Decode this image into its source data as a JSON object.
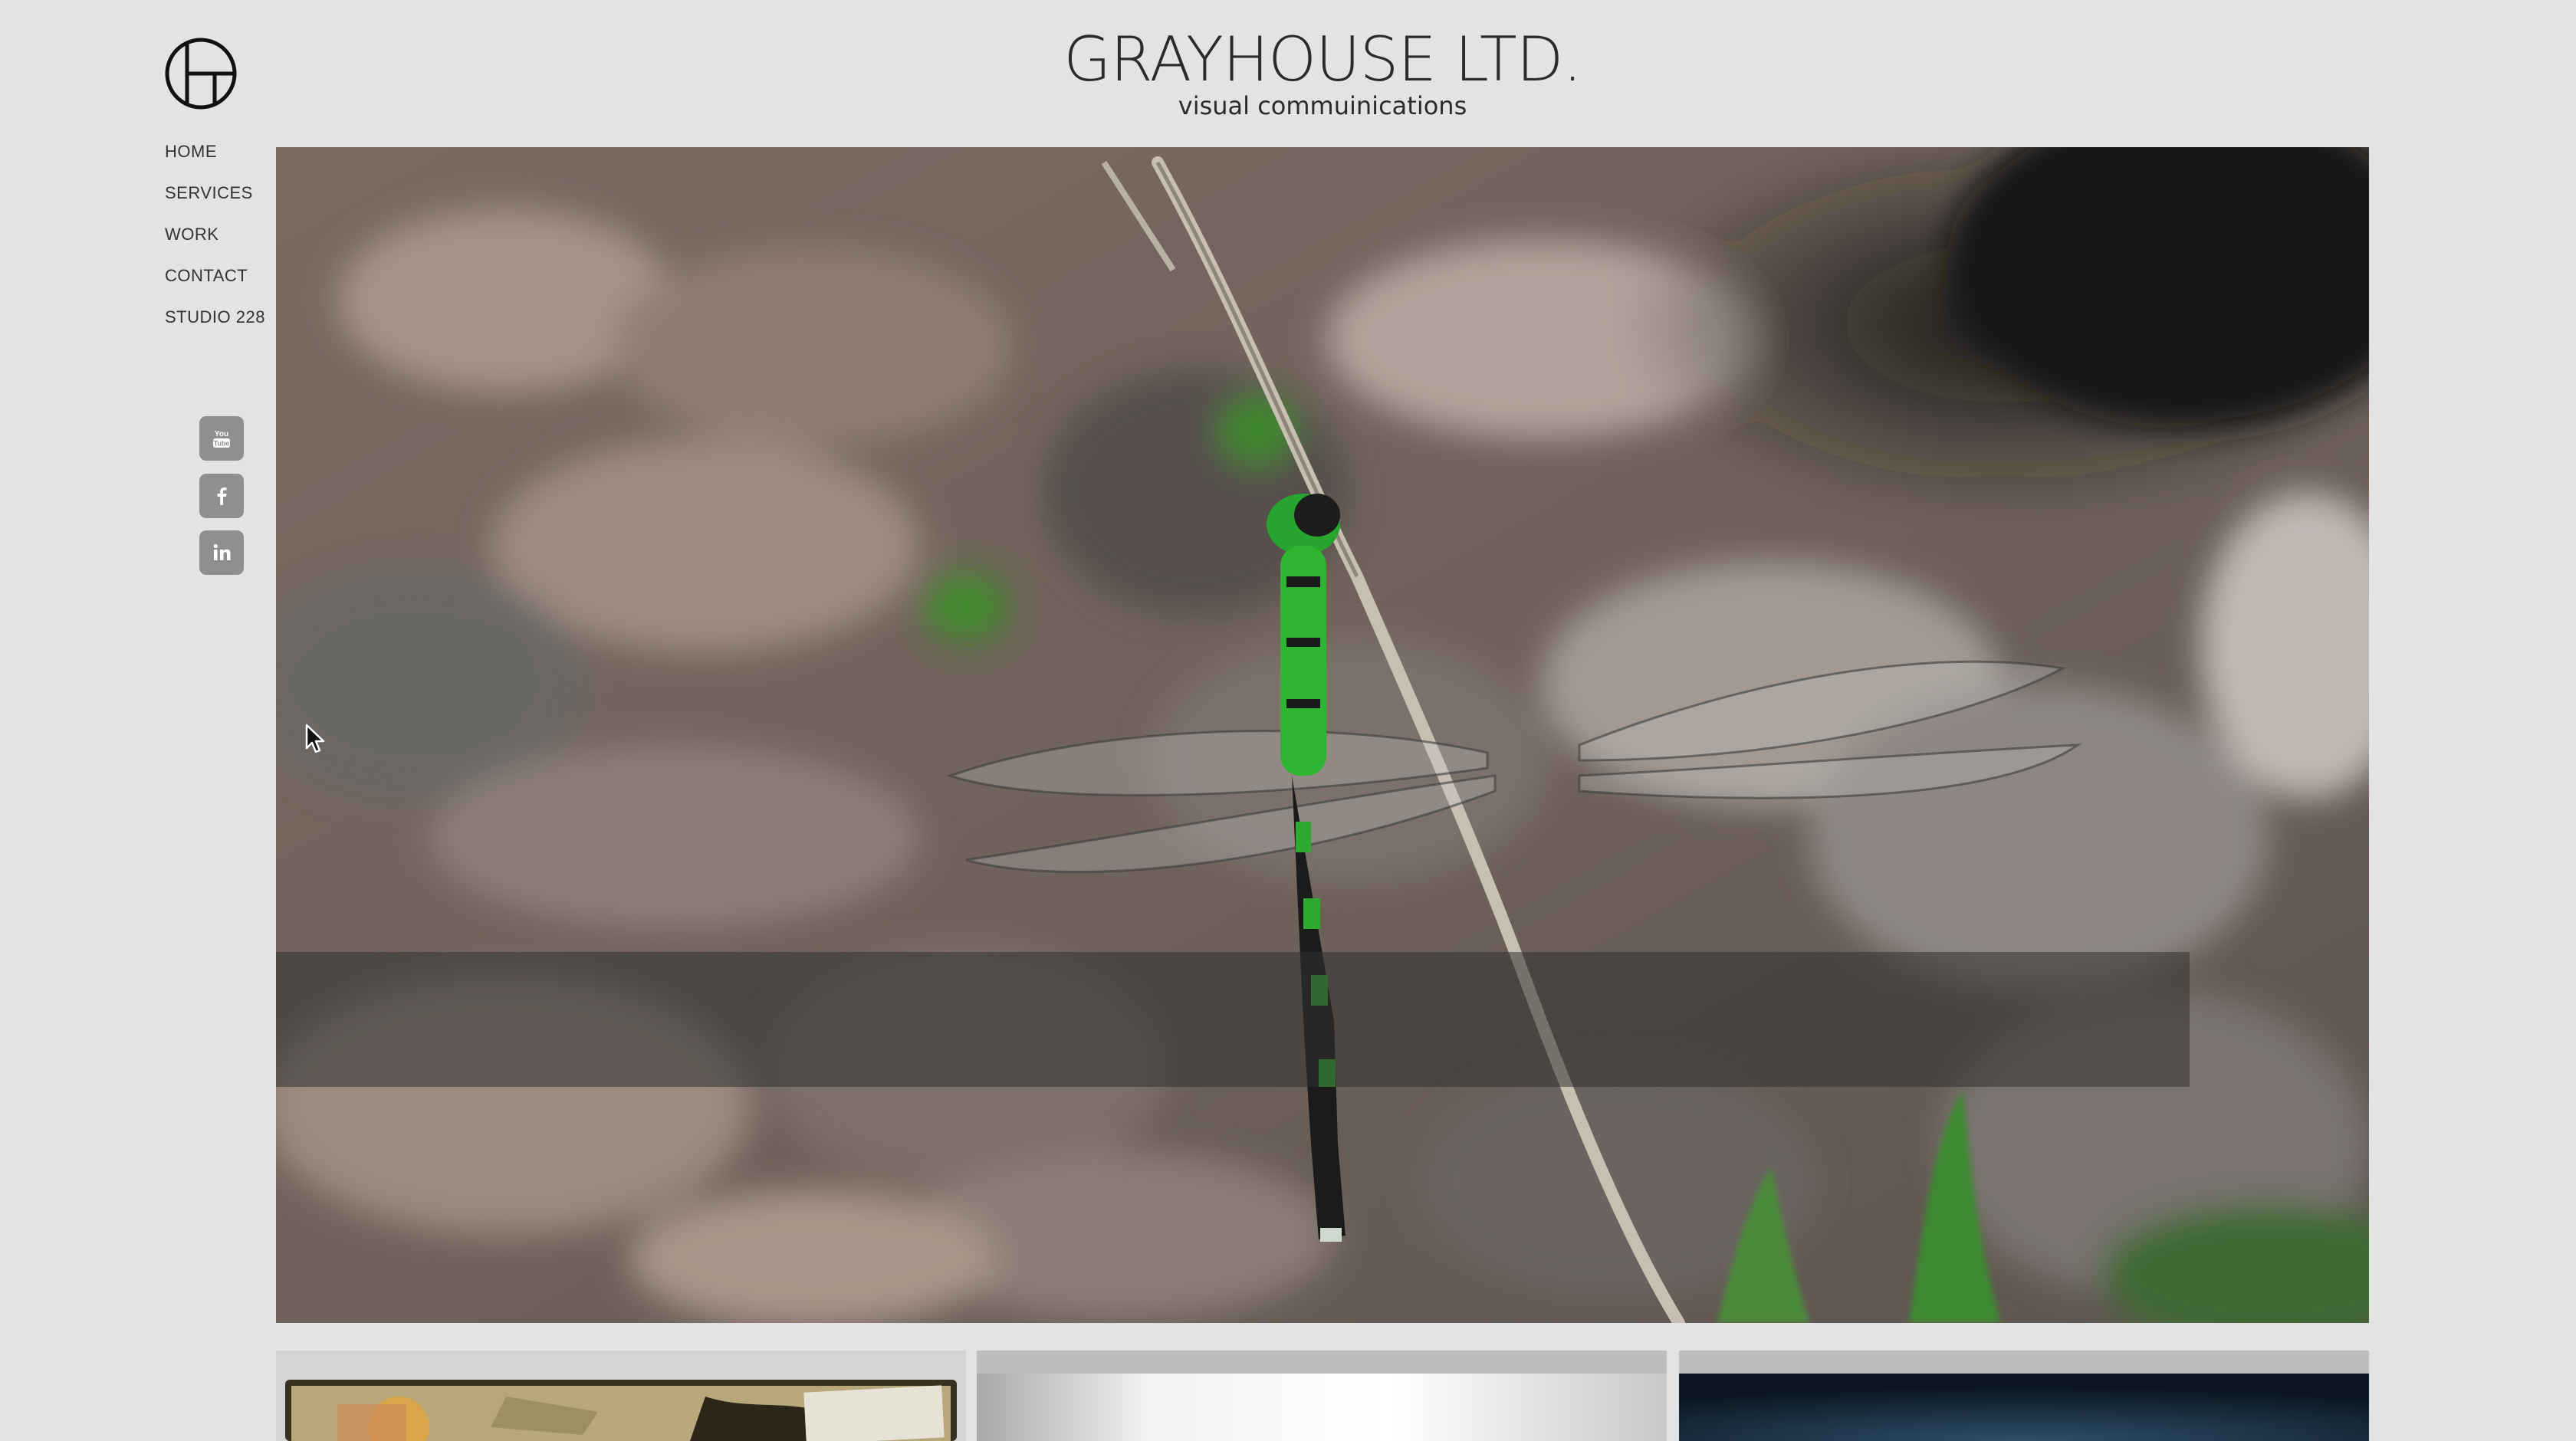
{
  "brand": {
    "title": "GRAYHOUSE LTD.",
    "subtitle": "visual commuinications"
  },
  "nav": {
    "items": [
      "HOME",
      "SERVICES",
      "WORK",
      "CONTACT",
      "STUDIO 228"
    ]
  },
  "social": [
    {
      "name": "youtube-icon",
      "label": "You Tube"
    },
    {
      "name": "facebook-icon",
      "label": "f"
    },
    {
      "name": "linkedin-icon",
      "label": "in"
    }
  ],
  "colors": {
    "background": "#e3e3e3",
    "social_icon_bg": "#8f8f8f",
    "caption_bar": "#323232"
  }
}
